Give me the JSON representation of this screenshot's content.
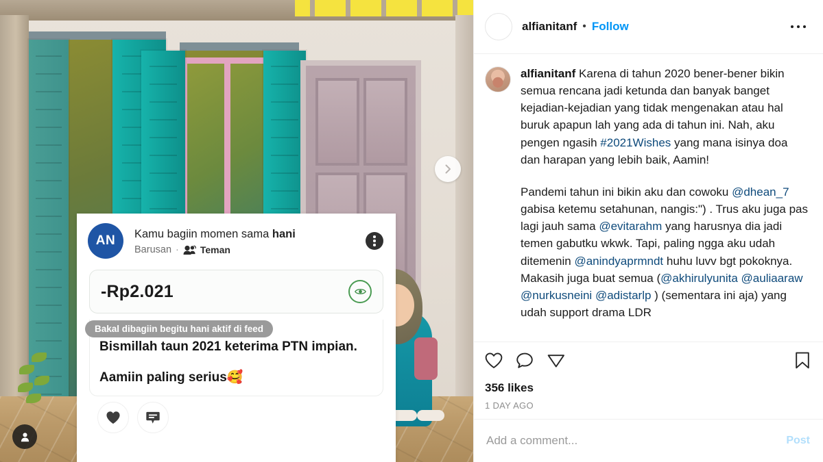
{
  "post": {
    "header": {
      "username": "alfianitanf",
      "separator": "•",
      "follow_label": "Follow",
      "more_icon": "more-options-icon"
    },
    "caption": {
      "username": "alfianitanf",
      "paragraph1_parts": [
        {
          "type": "text",
          "value": " Karena di tahun 2020 bener-bener bikin semua rencana jadi ketunda dan banyak banget kejadian-kejadian yang tidak mengenakan atau hal buruk apapun lah yang ada di tahun ini. Nah, aku pengen ngasih "
        },
        {
          "type": "link",
          "value": "#2021Wishes"
        },
        {
          "type": "text",
          "value": " yang mana isinya doa dan harapan yang lebih baik, Aamin!"
        }
      ],
      "paragraph2_parts": [
        {
          "type": "text",
          "value": "Pandemi tahun ini bikin aku dan cowoku "
        },
        {
          "type": "link",
          "value": "@dhean_7"
        },
        {
          "type": "text",
          "value": " gabisa ketemu setahunan, nangis:\") . Trus aku juga pas lagi jauh sama "
        },
        {
          "type": "link",
          "value": "@evitarahm"
        },
        {
          "type": "text",
          "value": " yang harusnya dia jadi temen gabutku wkwk. Tapi, paling ngga aku udah ditemenin "
        },
        {
          "type": "link",
          "value": "@anindyaprmndt"
        },
        {
          "type": "text",
          "value": " huhu luvv bgt pokoknya. Makasih juga buat semua ("
        },
        {
          "type": "link",
          "value": "@akhirulyunita"
        },
        {
          "type": "text",
          "value": " "
        },
        {
          "type": "link",
          "value": "@auliaaraw"
        },
        {
          "type": "text",
          "value": " "
        },
        {
          "type": "link",
          "value": "@nurkusneini"
        },
        {
          "type": "text",
          "value": " "
        },
        {
          "type": "link",
          "value": "@adistarlp"
        },
        {
          "type": "text",
          "value": " ) (sementara ini aja) yang udah support drama LDR"
        }
      ]
    },
    "actions": {
      "like_icon": "heart-icon",
      "comment_icon": "comment-icon",
      "share_icon": "share-paper-plane-icon",
      "save_icon": "bookmark-icon",
      "likes": "356 likes",
      "timestamp": "1 DAY AGO"
    },
    "comment_box": {
      "placeholder": "Add a comment...",
      "post_label": "Post"
    },
    "media": {
      "next_icon": "chevron-right-icon",
      "tag_icon": "person-tag-icon"
    }
  },
  "overlay_card": {
    "avatar_initials": "AN",
    "title_prefix": "Kamu bagiin momen sama ",
    "title_bold": "hani",
    "time": "Barusan",
    "dot": "·",
    "audience_icon": "friends-group-icon",
    "audience": "Teman",
    "kebab_icon": "more-vertical-icon",
    "amount": "-Rp2.021",
    "eye_icon": "eye-visibility-icon",
    "tooltip": "Bakal dibagiin begitu hani aktif di feed",
    "message_line1": "Bismillah taun 2021 keterima PTN impian.",
    "message_line2": "Aamiin paling serius🥰",
    "like_icon": "heart-filled-icon",
    "comment_icon": "comment-bubble-icon"
  },
  "colors": {
    "link": "#0e4a7b",
    "follow_blue": "#0095f6",
    "post_blue": "#b2dffc",
    "avatar_blue": "#1f55a5",
    "eye_green": "#4a9b52",
    "shutter_teal": "#12a39c"
  }
}
